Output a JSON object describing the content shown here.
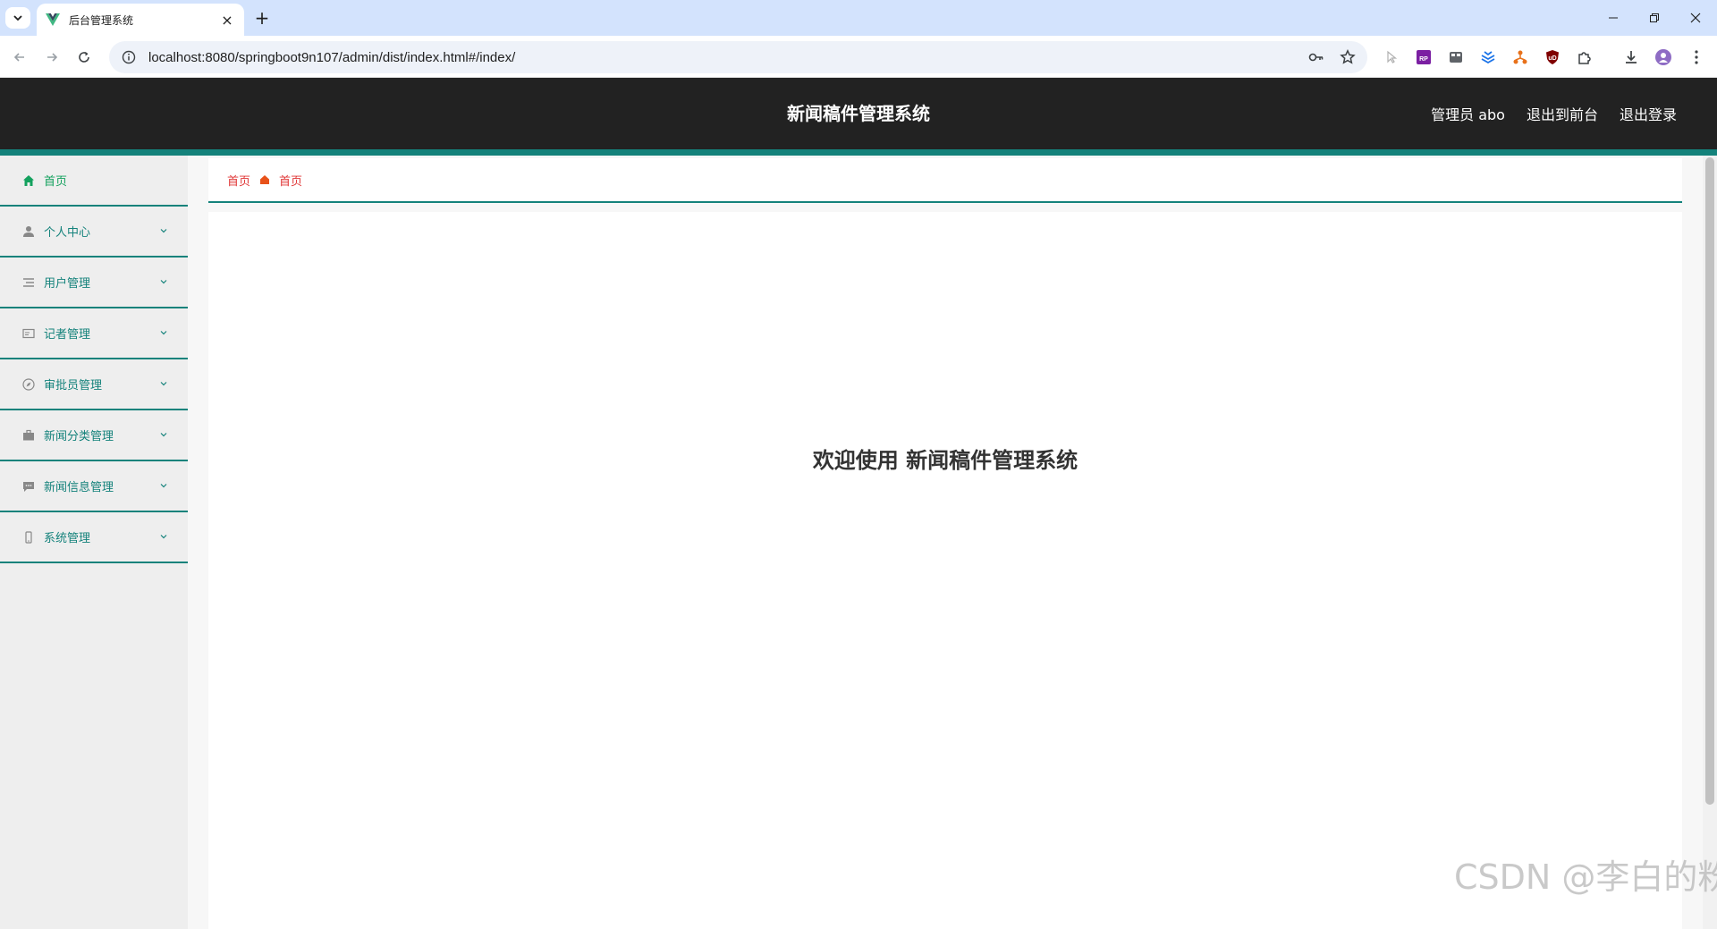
{
  "browser": {
    "tab_title": "后台管理系统",
    "new_tab_label": "+",
    "close_label": "×",
    "url": "localhost:8080/springboot9n107/admin/dist/index.html#/index/"
  },
  "header": {
    "title": "新闻稿件管理系统",
    "user": "管理员 abo",
    "front_link": "退出到前台",
    "logout_link": "退出登录"
  },
  "sidebar": {
    "items": [
      {
        "label": "首页",
        "icon": "home-icon"
      },
      {
        "label": "个人中心",
        "icon": "user-icon"
      },
      {
        "label": "用户管理",
        "icon": "list-icon"
      },
      {
        "label": "记者管理",
        "icon": "card-icon"
      },
      {
        "label": "审批员管理",
        "icon": "compass-icon"
      },
      {
        "label": "新闻分类管理",
        "icon": "briefcase-icon"
      },
      {
        "label": "新闻信息管理",
        "icon": "message-icon"
      },
      {
        "label": "系统管理",
        "icon": "phone-icon"
      }
    ]
  },
  "breadcrumb": {
    "first": "首页",
    "second": "首页"
  },
  "main": {
    "welcome": "欢迎使用 新闻稿件管理系统"
  },
  "watermark": "CSDN @李白的粉",
  "colors": {
    "header_bg": "#222222",
    "accent": "#14827b",
    "breadcrumb_text": "#e03636",
    "sidebar_bg": "#eeeeee"
  }
}
